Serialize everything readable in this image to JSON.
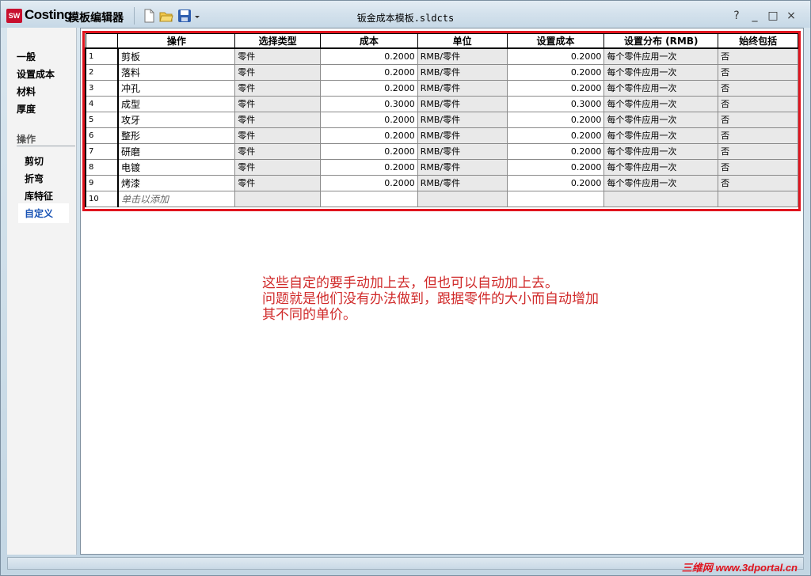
{
  "app": {
    "logo": "SW",
    "name": "Costing",
    "subtitle": "模板编辑器",
    "document_title": "钣金成本模板.sldcts"
  },
  "toolbar": {
    "icons": [
      "new-document-icon",
      "open-folder-icon",
      "save-icon",
      "dropdown-arrow-icon"
    ]
  },
  "window_controls": {
    "help": "?",
    "minimize": "_",
    "maximize": "□",
    "close": "×"
  },
  "sidebar": {
    "items": [
      "一般",
      "设置成本",
      "材料",
      "厚度"
    ],
    "section_title": "操作",
    "sub_items": [
      "剪切",
      "折弯",
      "库特征",
      "自定义"
    ],
    "active": "自定义"
  },
  "grid": {
    "columns": [
      "",
      "操作",
      "选择类型",
      "成本",
      "单位",
      "设置成本",
      "设置分布 (RMB)",
      "始终包括"
    ],
    "rows": [
      {
        "idx": "1",
        "op": "剪板",
        "type": "零件",
        "cost": "0.2000",
        "unit": "RMB/零件",
        "setup": "0.2000",
        "dist": "每个零件应用一次",
        "always": "否"
      },
      {
        "idx": "2",
        "op": "落料",
        "type": "零件",
        "cost": "0.2000",
        "unit": "RMB/零件",
        "setup": "0.2000",
        "dist": "每个零件应用一次",
        "always": "否"
      },
      {
        "idx": "3",
        "op": "冲孔",
        "type": "零件",
        "cost": "0.2000",
        "unit": "RMB/零件",
        "setup": "0.2000",
        "dist": "每个零件应用一次",
        "always": "否"
      },
      {
        "idx": "4",
        "op": "成型",
        "type": "零件",
        "cost": "0.3000",
        "unit": "RMB/零件",
        "setup": "0.3000",
        "dist": "每个零件应用一次",
        "always": "否"
      },
      {
        "idx": "5",
        "op": "攻牙",
        "type": "零件",
        "cost": "0.2000",
        "unit": "RMB/零件",
        "setup": "0.2000",
        "dist": "每个零件应用一次",
        "always": "否"
      },
      {
        "idx": "6",
        "op": "整形",
        "type": "零件",
        "cost": "0.2000",
        "unit": "RMB/零件",
        "setup": "0.2000",
        "dist": "每个零件应用一次",
        "always": "否"
      },
      {
        "idx": "7",
        "op": "研磨",
        "type": "零件",
        "cost": "0.2000",
        "unit": "RMB/零件",
        "setup": "0.2000",
        "dist": "每个零件应用一次",
        "always": "否"
      },
      {
        "idx": "8",
        "op": "电镀",
        "type": "零件",
        "cost": "0.2000",
        "unit": "RMB/零件",
        "setup": "0.2000",
        "dist": "每个零件应用一次",
        "always": "否"
      },
      {
        "idx": "9",
        "op": "烤漆",
        "type": "零件",
        "cost": "0.2000",
        "unit": "RMB/零件",
        "setup": "0.2000",
        "dist": "每个零件应用一次",
        "always": "否"
      }
    ],
    "new_row": {
      "idx": "10",
      "placeholder": "单击以添加"
    }
  },
  "annotation": [
    "这些自定的要手动加上去，但也可以自动加上去。",
    "问题就是他们没有办法做到，跟据零件的大小而自动增加",
    "其不同的单价。"
  ],
  "watermark": "三维网 www.3dportal.cn",
  "colors": {
    "highlight_border": "#e0141e",
    "annotation_text": "#d02a2a",
    "active_sidebar": "#1a54b5"
  }
}
